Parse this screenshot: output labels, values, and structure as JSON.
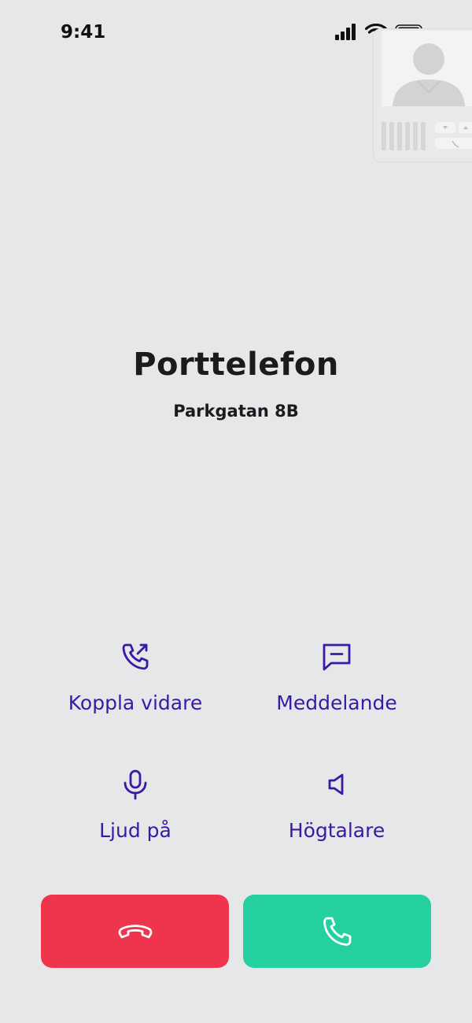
{
  "status_bar": {
    "time": "9:41",
    "icons": [
      "signal-icon",
      "wifi-icon",
      "battery-icon"
    ]
  },
  "camera_preview": {
    "icon": "intercom-camera-icon"
  },
  "caller": {
    "name": "Porttelefon",
    "address": "Parkgatan 8B"
  },
  "actions": [
    {
      "label": "Koppla vidare",
      "icon": "call-forward-icon"
    },
    {
      "label": "Meddelande",
      "icon": "message-icon"
    },
    {
      "label": "Ljud på",
      "icon": "microphone-icon"
    },
    {
      "label": "Högtalare",
      "icon": "speaker-icon"
    }
  ],
  "buttons": {
    "decline": {
      "icon": "hang-up-icon",
      "color": "#ef344d"
    },
    "accept": {
      "icon": "phone-icon",
      "color": "#24cfa0"
    }
  },
  "colors": {
    "accent": "#3a1aa4",
    "background": "#e6e7e9"
  }
}
